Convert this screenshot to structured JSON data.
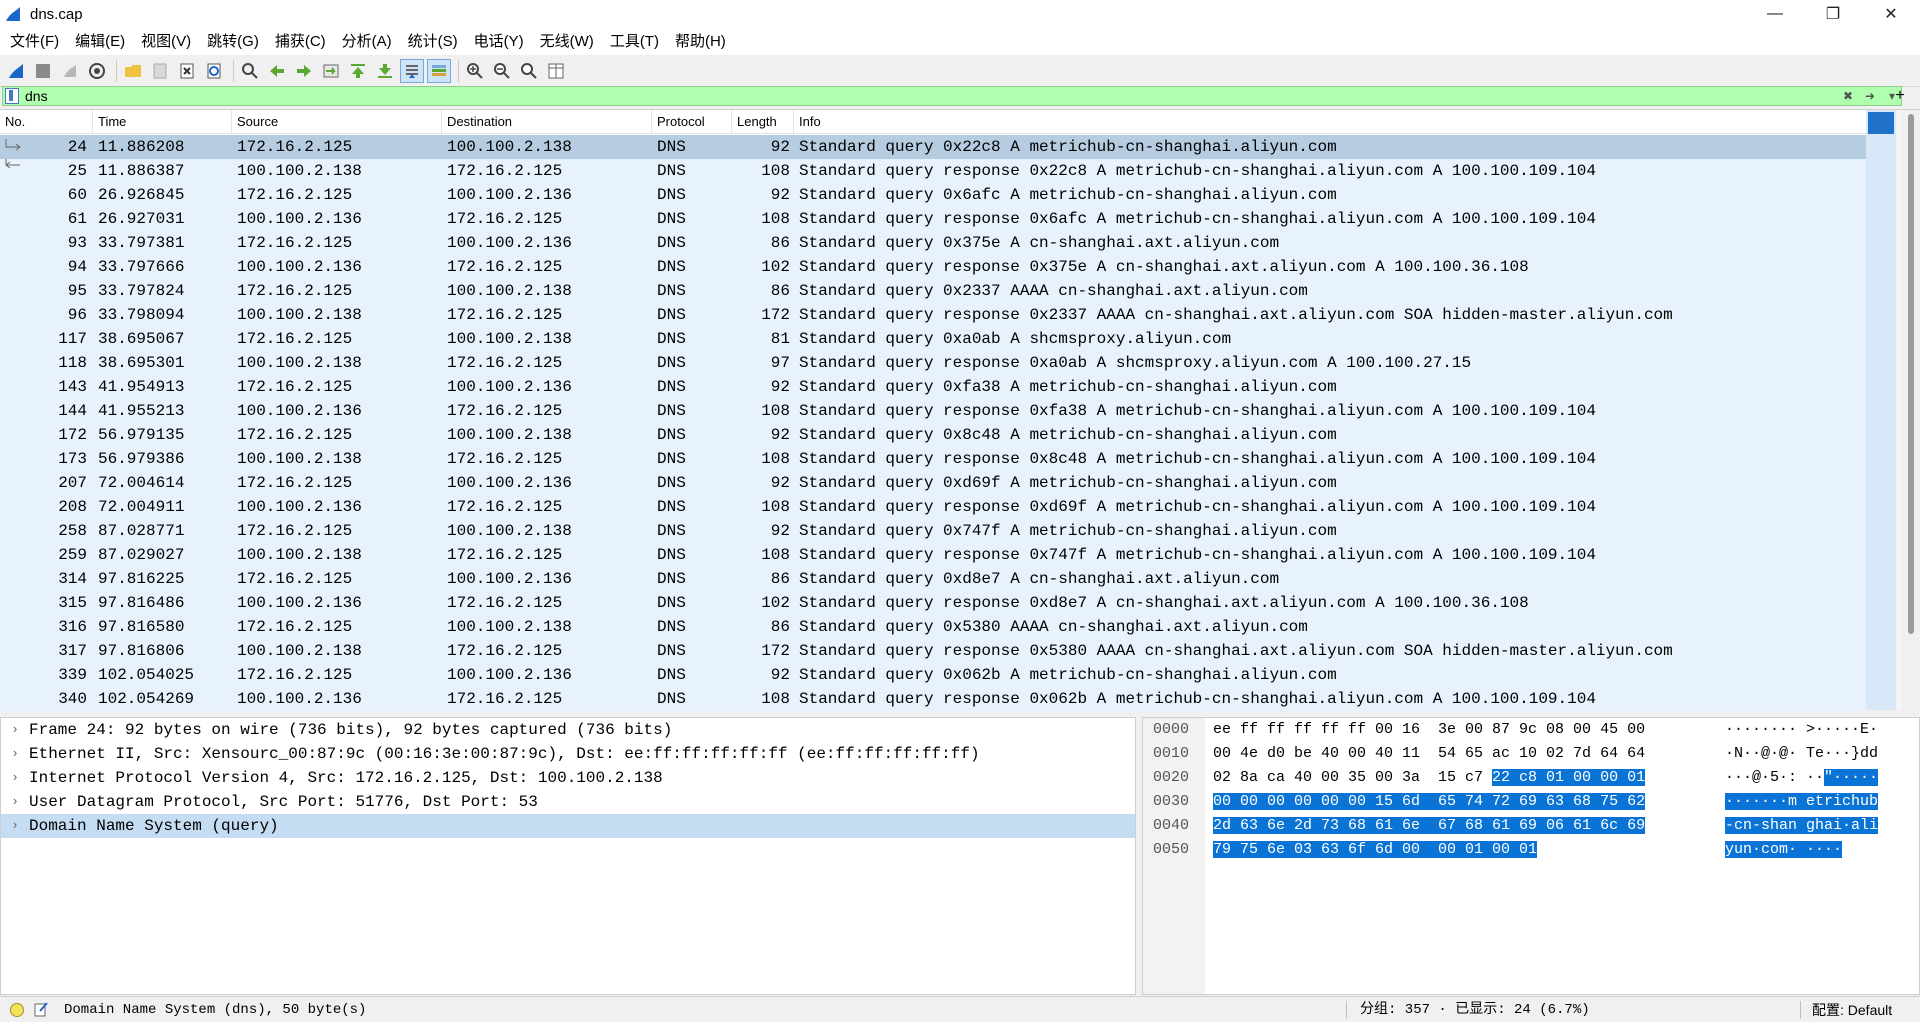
{
  "window": {
    "title": "dns.cap"
  },
  "menu": [
    "文件(F)",
    "编辑(E)",
    "视图(V)",
    "跳转(G)",
    "捕获(C)",
    "分析(A)",
    "统计(S)",
    "电话(Y)",
    "无线(W)",
    "工具(T)",
    "帮助(H)"
  ],
  "filter": {
    "value": "dns"
  },
  "columns": {
    "no": "No.",
    "time": "Time",
    "source": "Source",
    "destination": "Destination",
    "protocol": "Protocol",
    "length": "Length",
    "info": "Info"
  },
  "packets": [
    {
      "no": "24",
      "time": "11.886208",
      "src": "172.16.2.125",
      "dst": "100.100.2.138",
      "proto": "DNS",
      "len": "92",
      "info": "Standard query 0x22c8 A metrichub-cn-shanghai.aliyun.com"
    },
    {
      "no": "25",
      "time": "11.886387",
      "src": "100.100.2.138",
      "dst": "172.16.2.125",
      "proto": "DNS",
      "len": "108",
      "info": "Standard query response 0x22c8 A metrichub-cn-shanghai.aliyun.com A 100.100.109.104"
    },
    {
      "no": "60",
      "time": "26.926845",
      "src": "172.16.2.125",
      "dst": "100.100.2.136",
      "proto": "DNS",
      "len": "92",
      "info": "Standard query 0x6afc A metrichub-cn-shanghai.aliyun.com"
    },
    {
      "no": "61",
      "time": "26.927031",
      "src": "100.100.2.136",
      "dst": "172.16.2.125",
      "proto": "DNS",
      "len": "108",
      "info": "Standard query response 0x6afc A metrichub-cn-shanghai.aliyun.com A 100.100.109.104"
    },
    {
      "no": "93",
      "time": "33.797381",
      "src": "172.16.2.125",
      "dst": "100.100.2.136",
      "proto": "DNS",
      "len": "86",
      "info": "Standard query 0x375e A cn-shanghai.axt.aliyun.com"
    },
    {
      "no": "94",
      "time": "33.797666",
      "src": "100.100.2.136",
      "dst": "172.16.2.125",
      "proto": "DNS",
      "len": "102",
      "info": "Standard query response 0x375e A cn-shanghai.axt.aliyun.com A 100.100.36.108"
    },
    {
      "no": "95",
      "time": "33.797824",
      "src": "172.16.2.125",
      "dst": "100.100.2.138",
      "proto": "DNS",
      "len": "86",
      "info": "Standard query 0x2337 AAAA cn-shanghai.axt.aliyun.com"
    },
    {
      "no": "96",
      "time": "33.798094",
      "src": "100.100.2.138",
      "dst": "172.16.2.125",
      "proto": "DNS",
      "len": "172",
      "info": "Standard query response 0x2337 AAAA cn-shanghai.axt.aliyun.com SOA hidden-master.aliyun.com"
    },
    {
      "no": "117",
      "time": "38.695067",
      "src": "172.16.2.125",
      "dst": "100.100.2.138",
      "proto": "DNS",
      "len": "81",
      "info": "Standard query 0xa0ab A shcmsproxy.aliyun.com"
    },
    {
      "no": "118",
      "time": "38.695301",
      "src": "100.100.2.138",
      "dst": "172.16.2.125",
      "proto": "DNS",
      "len": "97",
      "info": "Standard query response 0xa0ab A shcmsproxy.aliyun.com A 100.100.27.15"
    },
    {
      "no": "143",
      "time": "41.954913",
      "src": "172.16.2.125",
      "dst": "100.100.2.136",
      "proto": "DNS",
      "len": "92",
      "info": "Standard query 0xfa38 A metrichub-cn-shanghai.aliyun.com"
    },
    {
      "no": "144",
      "time": "41.955213",
      "src": "100.100.2.136",
      "dst": "172.16.2.125",
      "proto": "DNS",
      "len": "108",
      "info": "Standard query response 0xfa38 A metrichub-cn-shanghai.aliyun.com A 100.100.109.104"
    },
    {
      "no": "172",
      "time": "56.979135",
      "src": "172.16.2.125",
      "dst": "100.100.2.138",
      "proto": "DNS",
      "len": "92",
      "info": "Standard query 0x8c48 A metrichub-cn-shanghai.aliyun.com"
    },
    {
      "no": "173",
      "time": "56.979386",
      "src": "100.100.2.138",
      "dst": "172.16.2.125",
      "proto": "DNS",
      "len": "108",
      "info": "Standard query response 0x8c48 A metrichub-cn-shanghai.aliyun.com A 100.100.109.104"
    },
    {
      "no": "207",
      "time": "72.004614",
      "src": "172.16.2.125",
      "dst": "100.100.2.136",
      "proto": "DNS",
      "len": "92",
      "info": "Standard query 0xd69f A metrichub-cn-shanghai.aliyun.com"
    },
    {
      "no": "208",
      "time": "72.004911",
      "src": "100.100.2.136",
      "dst": "172.16.2.125",
      "proto": "DNS",
      "len": "108",
      "info": "Standard query response 0xd69f A metrichub-cn-shanghai.aliyun.com A 100.100.109.104"
    },
    {
      "no": "258",
      "time": "87.028771",
      "src": "172.16.2.125",
      "dst": "100.100.2.138",
      "proto": "DNS",
      "len": "92",
      "info": "Standard query 0x747f A metrichub-cn-shanghai.aliyun.com"
    },
    {
      "no": "259",
      "time": "87.029027",
      "src": "100.100.2.138",
      "dst": "172.16.2.125",
      "proto": "DNS",
      "len": "108",
      "info": "Standard query response 0x747f A metrichub-cn-shanghai.aliyun.com A 100.100.109.104"
    },
    {
      "no": "314",
      "time": "97.816225",
      "src": "172.16.2.125",
      "dst": "100.100.2.136",
      "proto": "DNS",
      "len": "86",
      "info": "Standard query 0xd8e7 A cn-shanghai.axt.aliyun.com"
    },
    {
      "no": "315",
      "time": "97.816486",
      "src": "100.100.2.136",
      "dst": "172.16.2.125",
      "proto": "DNS",
      "len": "102",
      "info": "Standard query response 0xd8e7 A cn-shanghai.axt.aliyun.com A 100.100.36.108"
    },
    {
      "no": "316",
      "time": "97.816580",
      "src": "172.16.2.125",
      "dst": "100.100.2.138",
      "proto": "DNS",
      "len": "86",
      "info": "Standard query 0x5380 AAAA cn-shanghai.axt.aliyun.com"
    },
    {
      "no": "317",
      "time": "97.816806",
      "src": "100.100.2.138",
      "dst": "172.16.2.125",
      "proto": "DNS",
      "len": "172",
      "info": "Standard query response 0x5380 AAAA cn-shanghai.axt.aliyun.com SOA hidden-master.aliyun.com"
    },
    {
      "no": "339",
      "time": "102.054025",
      "src": "172.16.2.125",
      "dst": "100.100.2.136",
      "proto": "DNS",
      "len": "92",
      "info": "Standard query 0x062b A metrichub-cn-shanghai.aliyun.com"
    },
    {
      "no": "340",
      "time": "102.054269",
      "src": "100.100.2.136",
      "dst": "172.16.2.125",
      "proto": "DNS",
      "len": "108",
      "info": "Standard query response 0x062b A metrichub-cn-shanghai.aliyun.com A 100.100.109.104"
    }
  ],
  "selected_packet_index": 0,
  "details": [
    {
      "label": "Frame 24: 92 bytes on wire (736 bits), 92 bytes captured (736 bits)",
      "selected": false
    },
    {
      "label": "Ethernet II, Src: Xensourc_00:87:9c (00:16:3e:00:87:9c), Dst: ee:ff:ff:ff:ff:ff (ee:ff:ff:ff:ff:ff)",
      "selected": false
    },
    {
      "label": "Internet Protocol Version 4, Src: 172.16.2.125, Dst: 100.100.2.138",
      "selected": false
    },
    {
      "label": "User Datagram Protocol, Src Port: 51776, Dst Port: 53",
      "selected": false
    },
    {
      "label": "Domain Name System (query)",
      "selected": true
    }
  ],
  "bytes": [
    {
      "offset": "0000",
      "hex_pre": "ee ff ff ff ff ff 00 16  3e 00 87 9c 08 00 45 00",
      "hex_hl": "",
      "asc_pre": "········ >·····E·",
      "asc_hl": ""
    },
    {
      "offset": "0010",
      "hex_pre": "00 4e d0 be 40 00 40 11  54 65 ac 10 02 7d 64 64",
      "hex_hl": "",
      "asc_pre": "·N··@·@· Te···}dd",
      "asc_hl": ""
    },
    {
      "offset": "0020",
      "hex_pre": "02 8a ca 40 00 35 00 3a  15 c7 ",
      "hex_hl": "22 c8 01 00 00 01",
      "asc_pre": "···@·5·: ··",
      "asc_hl": "\"·····"
    },
    {
      "offset": "0030",
      "hex_pre": "",
      "hex_hl": "00 00 00 00 00 00 15 6d  65 74 72 69 63 68 75 62",
      "asc_pre": "",
      "asc_hl": "·······m etrichub"
    },
    {
      "offset": "0040",
      "hex_pre": "",
      "hex_hl": "2d 63 6e 2d 73 68 61 6e  67 68 61 69 06 61 6c 69",
      "asc_pre": "",
      "asc_hl": "-cn-shan ghai·ali"
    },
    {
      "offset": "0050",
      "hex_pre": "",
      "hex_hl": "79 75 6e 03 63 6f 6d 00  00 01 00 01",
      "asc_pre": "",
      "asc_hl": "yun·com· ····"
    }
  ],
  "status": {
    "message": "Domain Name System (dns), 50 byte(s)",
    "stats": "分组: 357 · 已显示: 24 (6.7%)",
    "profile": "配置: Default"
  },
  "colors": {
    "row_bg": "#e7f2fd",
    "selected_row": "#b6cce0",
    "filter_bg": "#afffaf",
    "byte_highlight": "#0a74d6"
  }
}
